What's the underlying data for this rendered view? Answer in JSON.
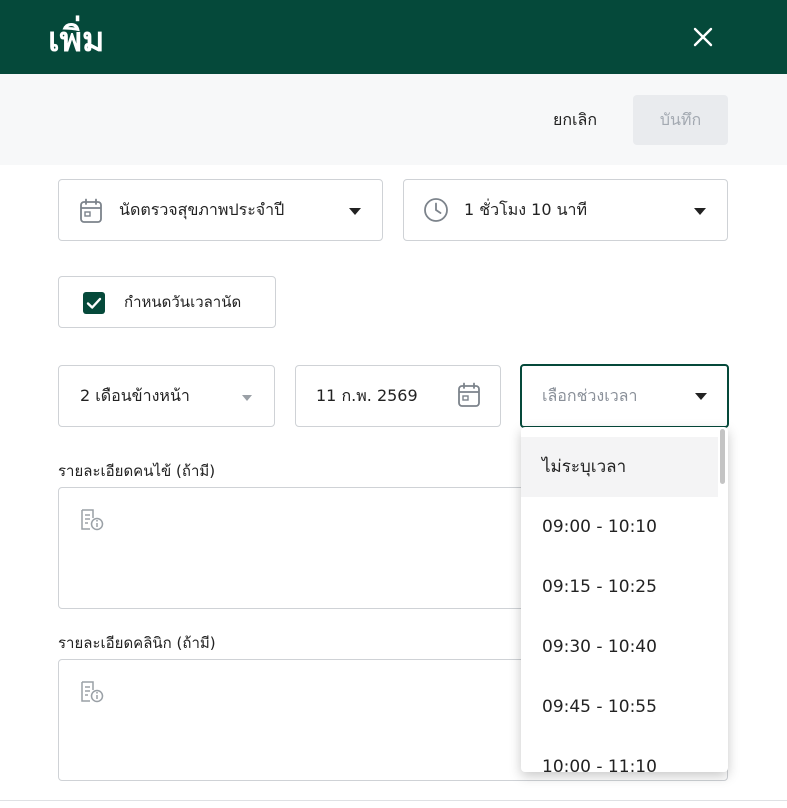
{
  "header": {
    "title": "เพิ่ม"
  },
  "toolbar": {
    "cancel_label": "ยกเลิก",
    "save_label": "บันทึก"
  },
  "form": {
    "appointment_type": {
      "value": "นัดตรวจสุขภาพประจำปี"
    },
    "duration": {
      "value": "1 ชั่วโมง 10 นาที"
    },
    "set_datetime": {
      "label": "กำหนดวันเวลานัด",
      "checked": true
    },
    "relative_date": {
      "value": "2 เดือนข้างหน้า"
    },
    "date": {
      "value": "11 ก.พ. 2569"
    },
    "time_slot": {
      "placeholder": "เลือกช่วงเวลา"
    },
    "patient_detail": {
      "label": "รายละเอียดคนไข้ (ถ้ามี)"
    },
    "clinic_detail": {
      "label": "รายละเอียดคลินิก (ถ้ามี)"
    }
  },
  "dropdown": {
    "options": [
      {
        "label": "ไม่ระบุเวลา"
      },
      {
        "label": "09:00 - 10:10"
      },
      {
        "label": "09:15 - 10:25"
      },
      {
        "label": "09:30 - 10:40"
      },
      {
        "label": "09:45 - 10:55"
      },
      {
        "label": "10:00 - 11:10"
      }
    ]
  },
  "colors": {
    "header_bg": "#05493a",
    "toolbar_bg": "#f7f8f9",
    "accent": "#05493a",
    "save_disabled_bg": "#e9ebee",
    "save_disabled_text": "#a3a9b1"
  },
  "icons": [
    "close-icon",
    "calendar-icon",
    "clock-icon",
    "checkmark-icon",
    "caret-down-icon",
    "note-info-icon"
  ]
}
